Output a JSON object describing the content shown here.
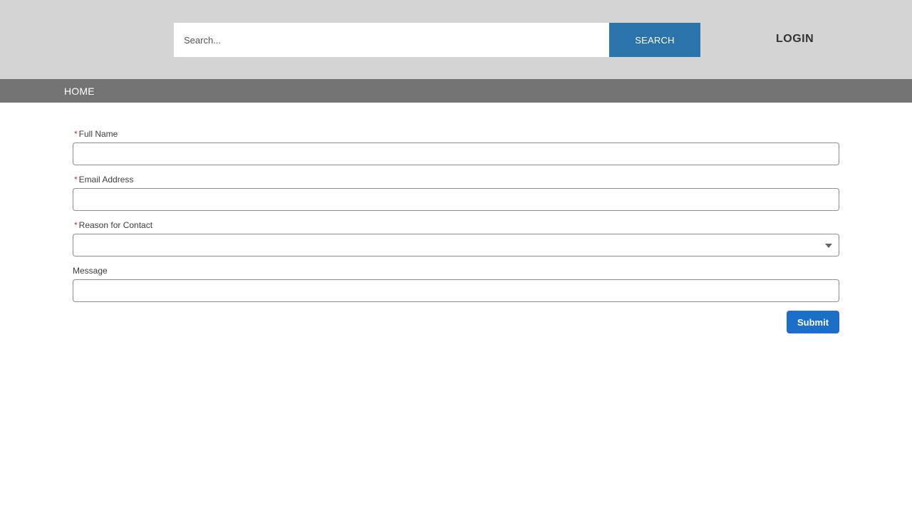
{
  "header": {
    "search": {
      "placeholder": "Search...",
      "value": "",
      "button_label": "SEARCH"
    },
    "login_label": "LOGIN"
  },
  "nav": {
    "items": [
      {
        "label": "HOME"
      }
    ]
  },
  "form": {
    "required_marker": "*",
    "fields": [
      {
        "label": "Full Name",
        "required": true,
        "value": ""
      },
      {
        "label": "Email Address",
        "required": true,
        "value": ""
      },
      {
        "label": "Reason for Contact",
        "required": true,
        "selected": ""
      },
      {
        "label": "Message",
        "required": false,
        "value": ""
      }
    ],
    "submit_label": "Submit"
  },
  "colors": {
    "header_bg": "#d4d4d4",
    "nav_bg": "#737373",
    "search_button": "#2a74ab",
    "submit_button": "#1b6fc9",
    "required_marker": "#c23934"
  }
}
